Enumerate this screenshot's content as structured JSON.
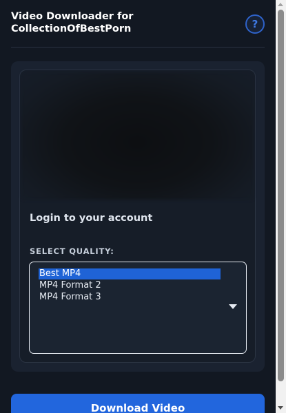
{
  "header": {
    "title": "Video Downloader for CollectionOfBestPorn",
    "help_label": "?"
  },
  "video": {
    "title": "Login to your account"
  },
  "quality": {
    "label": "SELECT QUALITY:",
    "options": [
      "Best MP4",
      "MP4 Format 2",
      "MP4 Format 3"
    ],
    "selected": "Best MP4"
  },
  "actions": {
    "download_label": "Download Video"
  },
  "colors": {
    "background": "#121822",
    "accent": "#2266dd",
    "selection": "#1f63d6"
  },
  "icons": {
    "help": "question-mark-icon",
    "dropdown": "triangle-down-icon"
  }
}
